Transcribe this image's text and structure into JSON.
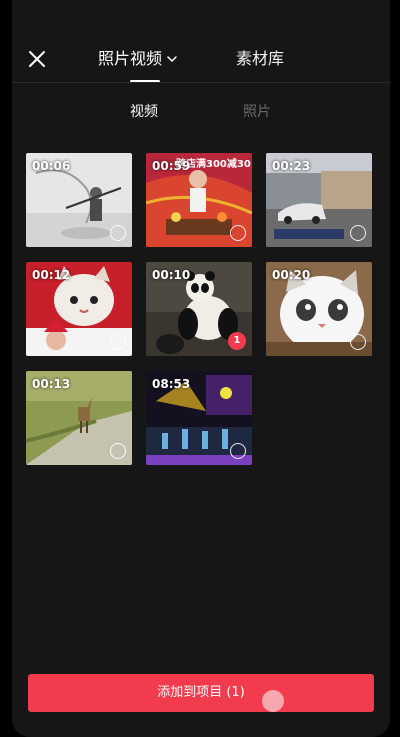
{
  "header": {
    "tab_photos_videos": "照片视频",
    "tab_library": "素材库"
  },
  "subtabs": {
    "video": "视频",
    "photo": "照片"
  },
  "thumbnails": [
    {
      "duration": "00:06",
      "selected": false
    },
    {
      "duration": "00:59",
      "selected": false,
      "overlay": "跨店满300减30"
    },
    {
      "duration": "00:23",
      "selected": false
    },
    {
      "duration": "00:12",
      "selected": false
    },
    {
      "duration": "00:10",
      "selected": true,
      "badge": "1"
    },
    {
      "duration": "00:20",
      "selected": false
    },
    {
      "duration": "00:13",
      "selected": false
    },
    {
      "duration": "08:53",
      "selected": false
    }
  ],
  "add_button_label": "添加到项目 (1)",
  "colors": {
    "accent": "#f23c4e",
    "background": "#161616"
  }
}
